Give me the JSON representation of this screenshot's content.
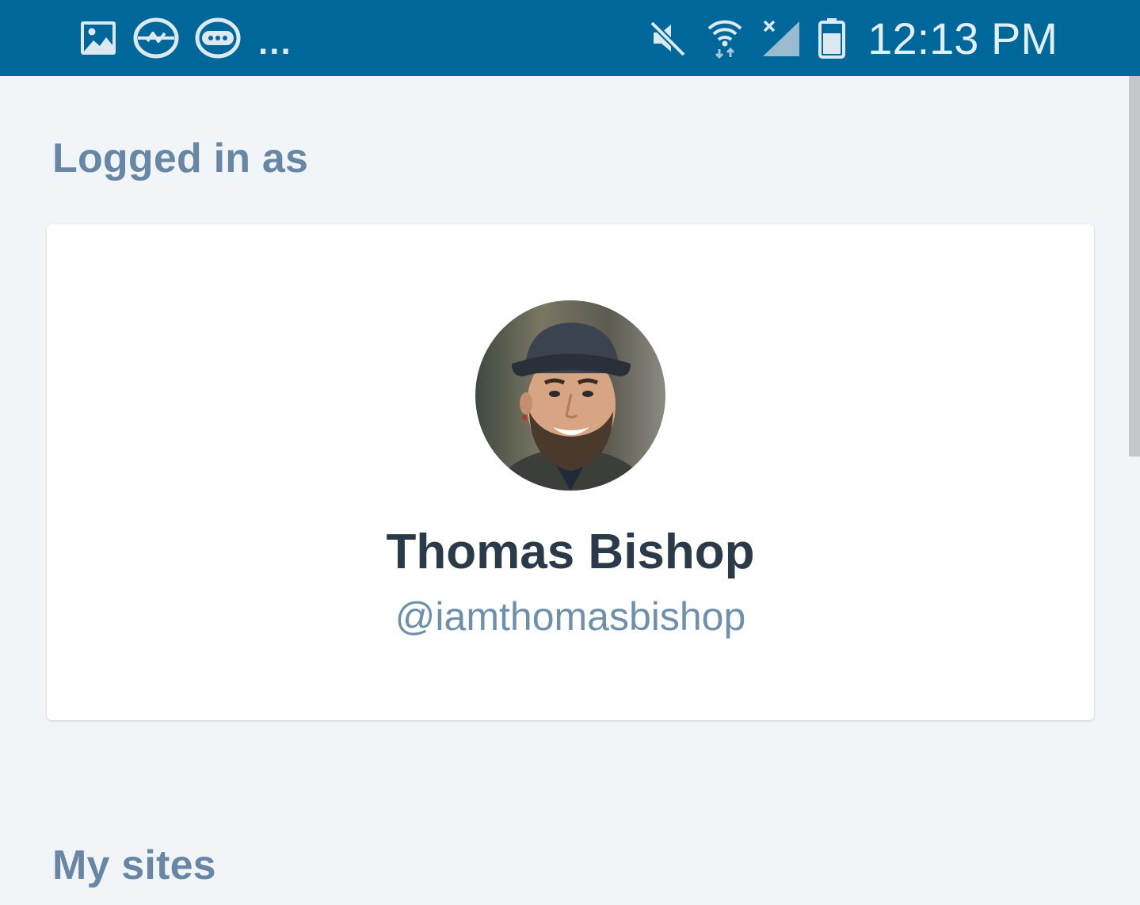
{
  "status_bar": {
    "time": "12:13 PM",
    "overflow_indicator": "...",
    "notification_icons": [
      "image-icon",
      "messenger-icon",
      "chat-bubble-icon"
    ],
    "system_icons": [
      "mute-icon",
      "wifi-icon",
      "signal-icon",
      "battery-icon"
    ]
  },
  "colors": {
    "status_bar_bg": "#00679a",
    "page_bg": "#f2f5f8",
    "heading": "#6887a4",
    "name": "#2b3a49",
    "username": "#6e90ac"
  },
  "sections": {
    "logged_in_heading": "Logged in as",
    "my_sites_heading": "My sites"
  },
  "profile": {
    "display_name": "Thomas Bishop",
    "username": "@iamthomasbishop"
  }
}
